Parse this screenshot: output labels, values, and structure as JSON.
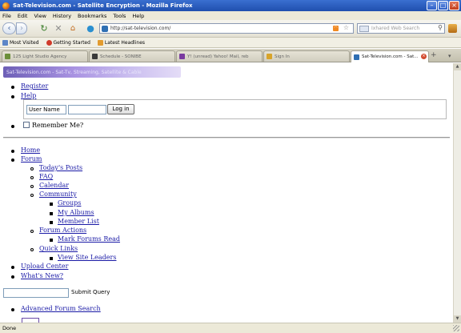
{
  "window": {
    "title": "Sat-Television.com - Satellite Encryption - Mozilla Firefox",
    "minimize": "–",
    "maximize": "□",
    "close": "×"
  },
  "menu": [
    "File",
    "Edit",
    "View",
    "History",
    "Bookmarks",
    "Tools",
    "Help"
  ],
  "nav": {
    "url": "http://sat-television.com/",
    "search_placeholder": "Ixhared Web Search"
  },
  "bookmarks": [
    "Most Visited",
    "Getting Started",
    "Latest Headlines"
  ],
  "tabs": [
    {
      "label": "125 Light Studio Agency",
      "color": "#6b8f3a"
    },
    {
      "label": "Schedule - SONIBE",
      "color": "#3a3a3a"
    },
    {
      "label": "Y! (unread) Yahoo! Mail, reb",
      "color": "#7a3aa0"
    },
    {
      "label": "Sign In",
      "color": "#d8a42a"
    },
    {
      "label": "Sat-Television.com - Sat...",
      "color": "#2f6fb3",
      "active": true
    }
  ],
  "icons": {
    "back": "back-arrow-icon",
    "forward": "forward-arrow-icon",
    "reload": "reload-icon",
    "stop": "stop-icon",
    "home": "home-icon",
    "new_tab": "new-tab-icon",
    "tab_list": "tab-list-icon"
  },
  "content": {
    "banner": "Sat-Television.com - Sat-Tv, Streaming, Satellite & Cable",
    "top_links": [
      "Register",
      "Help"
    ],
    "login": {
      "username_value": "User Name",
      "login_button": "Log in",
      "remember_me": "Remember Me?"
    },
    "nav_links": {
      "home": "Home",
      "forum": "Forum",
      "todays_posts": "Today's Posts",
      "faq": "FAQ",
      "calendar": "Calendar",
      "community": "Community",
      "groups": "Groups",
      "my_albums": "My Albums",
      "member_list": "Member List",
      "forum_actions": "Forum Actions",
      "mark_forums_read": "Mark Forums Read",
      "quick_links": "Quick Links",
      "view_site_leaders": "View Site Leaders",
      "upload_center": "Upload Center",
      "whats_new": "What's New?"
    },
    "submit_query": "Submit Query",
    "advanced_search": "Advanced Forum Search"
  },
  "status": {
    "text": "Done"
  }
}
